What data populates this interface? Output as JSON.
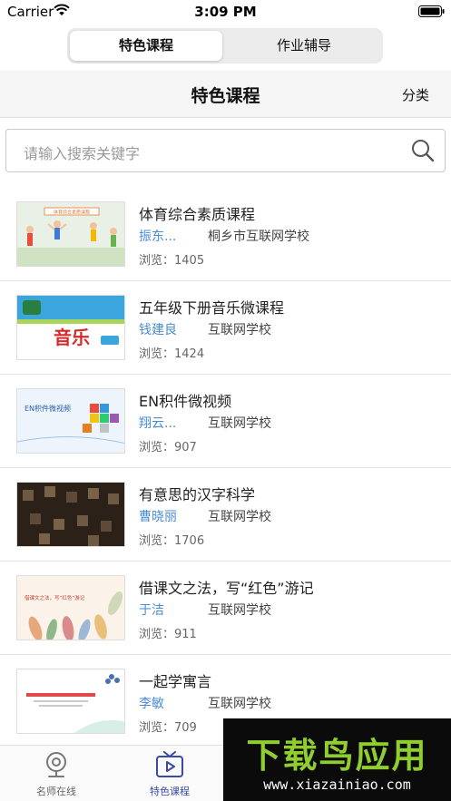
{
  "status_bar": {
    "carrier": "Carrier",
    "time": "3:09 PM"
  },
  "segments": [
    "特色课程",
    "作业辅导"
  ],
  "nav": {
    "title": "特色课程",
    "right": "分类"
  },
  "search": {
    "placeholder": "请输入搜索关键字"
  },
  "courses": [
    {
      "title": "体育综合素质课程",
      "teacher": "振东...",
      "school": "桐乡市互联网学校",
      "views": "浏览：1405",
      "thumb_text": "体育综合素质课程"
    },
    {
      "title": "五年级下册音乐微课程",
      "teacher": "钱建良",
      "school": "互联网学校",
      "views": "浏览：1424",
      "thumb_text": "音乐"
    },
    {
      "title": "EN积件微视频",
      "teacher": "翔云...",
      "school": "互联网学校",
      "views": "浏览：907",
      "thumb_text": "EN积件微视频"
    },
    {
      "title": "有意思的汉字科学",
      "teacher": "曹晓丽",
      "school": "互联网学校",
      "views": "浏览：1706",
      "thumb_text": ""
    },
    {
      "title": "借课文之法，写“红色”游记",
      "teacher": "于洁",
      "school": "互联网学校",
      "views": "浏览：911",
      "thumb_text": "借课文之法，写“红色”游记"
    },
    {
      "title": "一起学寓言",
      "teacher": "李敏",
      "school": "互联网学校",
      "views": "浏览：709",
      "thumb_text": ""
    }
  ],
  "tabs": [
    {
      "label": "名师在线",
      "icon": "webcam-icon"
    },
    {
      "label": "特色课程",
      "icon": "tv-play-icon"
    }
  ],
  "watermark": {
    "big": "下载鸟应用",
    "small": "www.xiazainiao.com"
  },
  "colors": {
    "link": "#4a8bd6",
    "tab_active": "#3b4aa5",
    "watermark_green": "#8fce2e"
  }
}
